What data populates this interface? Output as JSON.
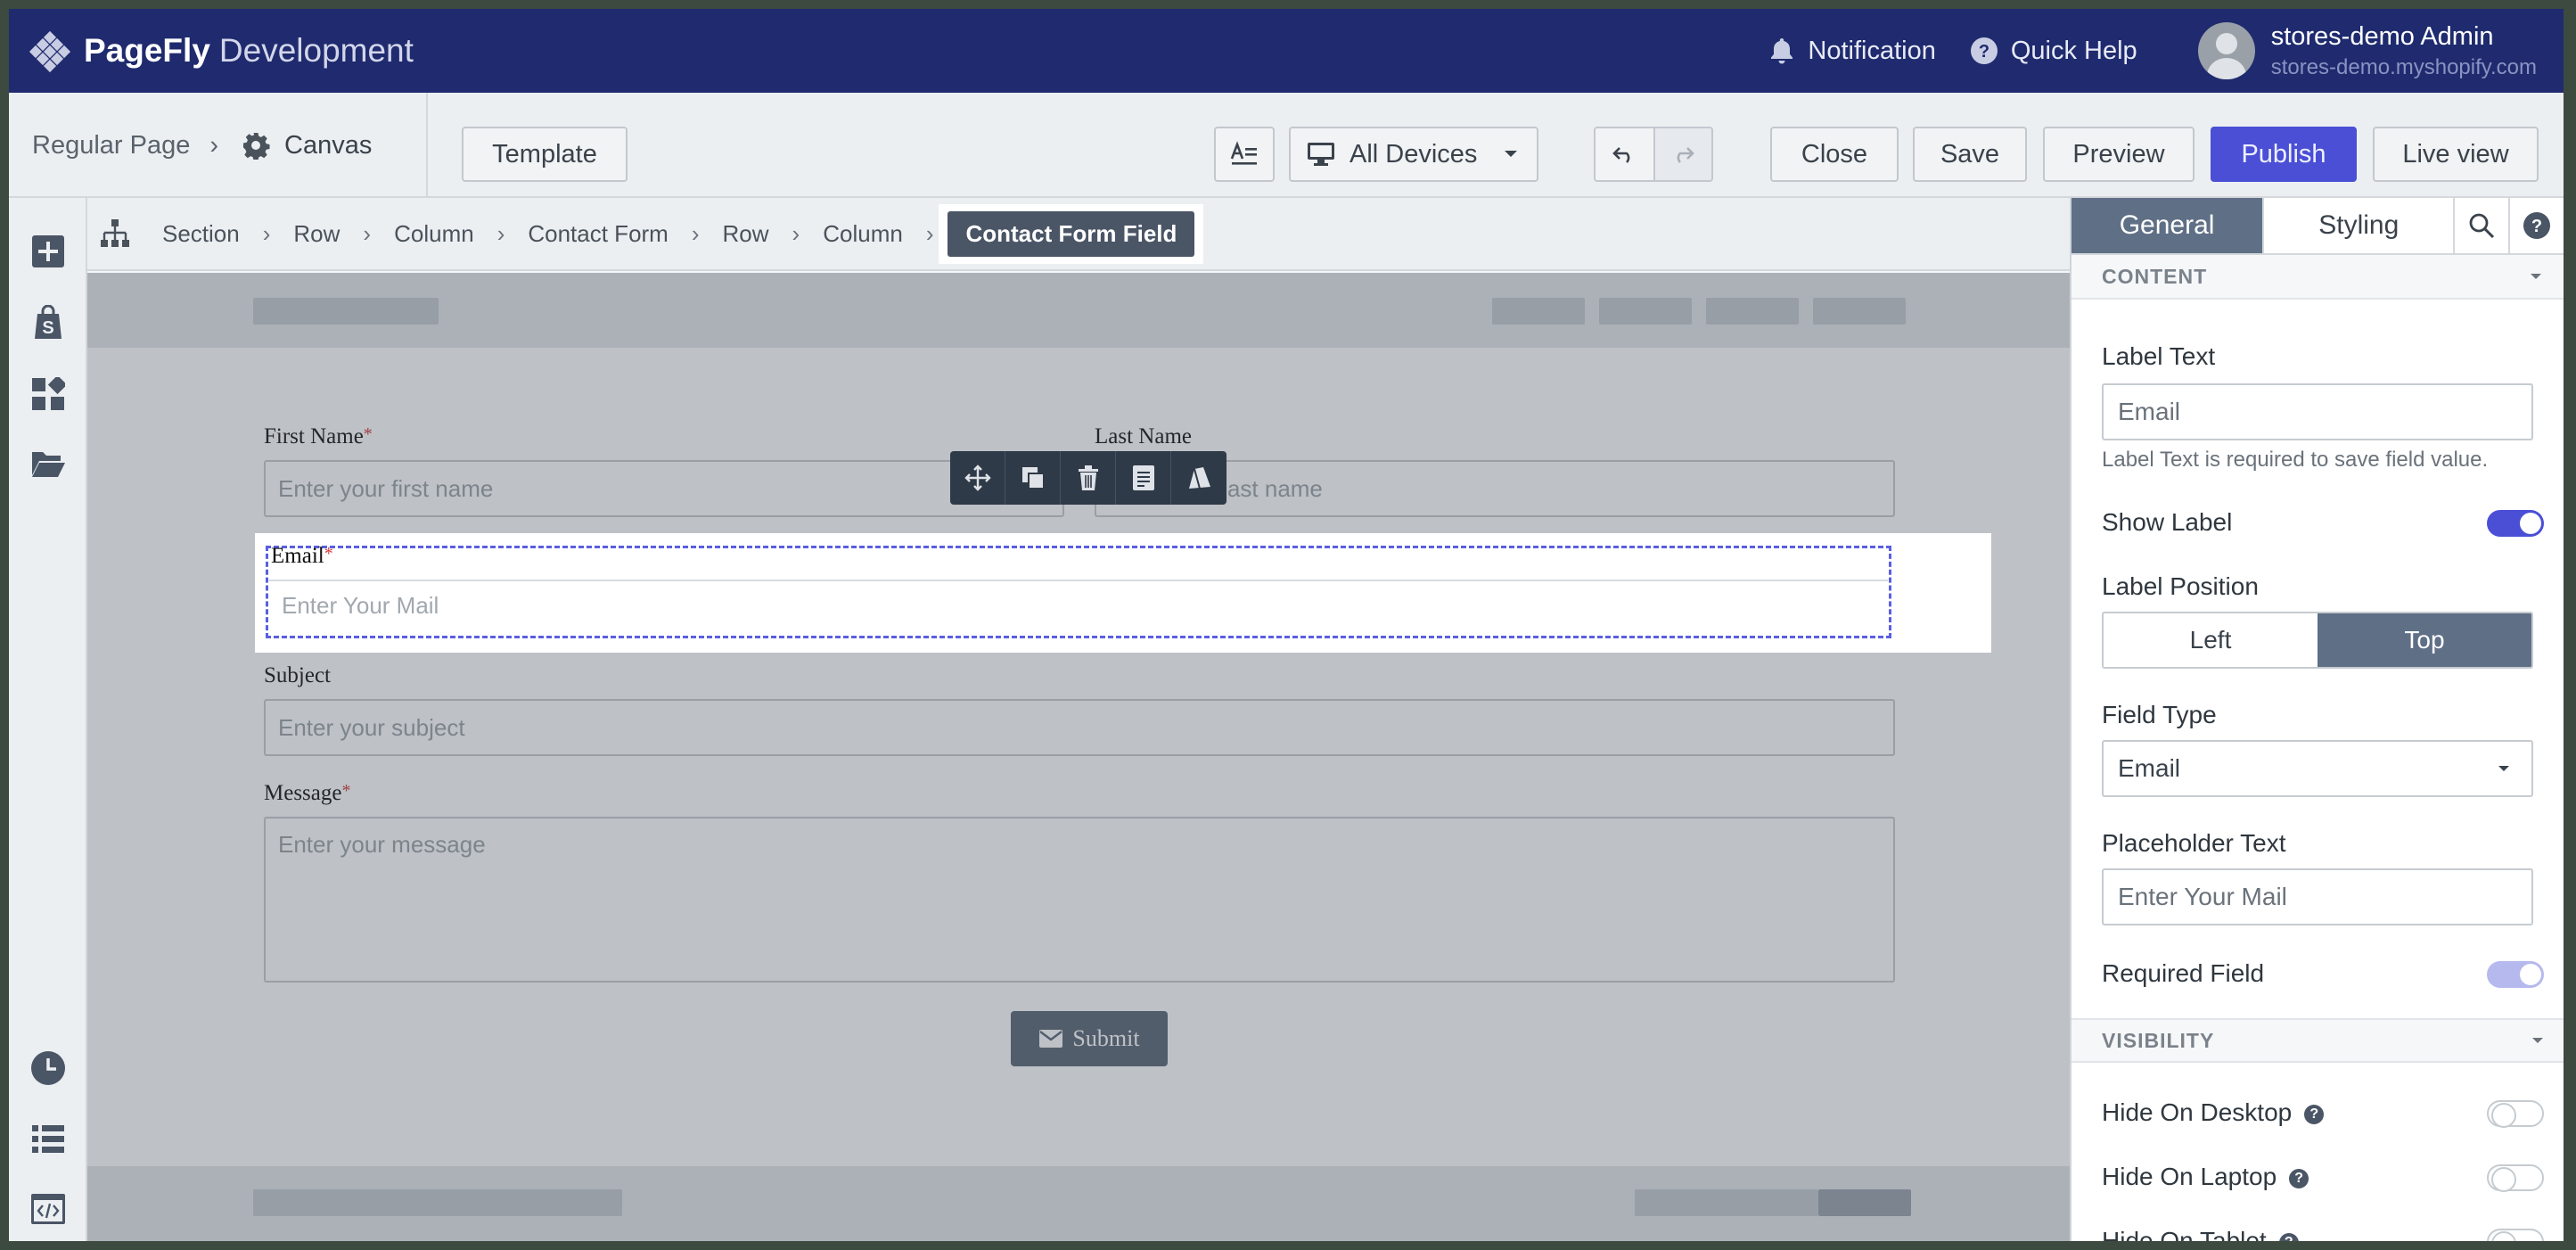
{
  "header": {
    "brand_name": "PageFly",
    "brand_env": "Development",
    "notification_label": "Notification",
    "help_label": "Quick Help",
    "user_name": "stores-demo Admin",
    "user_store": "stores-demo.myshopify.com"
  },
  "toolbar": {
    "page_type": "Regular Page",
    "canvas_label": "Canvas",
    "template_label": "Template",
    "device_label": "All Devices",
    "close_label": "Close",
    "save_label": "Save",
    "preview_label": "Preview",
    "publish_label": "Publish",
    "live_view_label": "Live view",
    "accent_color": "#4a4fd6"
  },
  "breadcrumb": {
    "items": [
      "Section",
      "Row",
      "Column",
      "Contact Form",
      "Row",
      "Column"
    ],
    "active": "Contact Form Field"
  },
  "form": {
    "first_name_label": "First Name",
    "first_name_placeholder": "Enter your first name",
    "last_name_label": "Last Name",
    "last_name_placeholder": "Enter your last name",
    "email_label": "Email",
    "email_placeholder": "Enter Your Mail",
    "subject_label": "Subject",
    "subject_placeholder": "Enter your subject",
    "message_label": "Message",
    "message_placeholder": "Enter your message",
    "submit_label": "Submit",
    "required_mark": "*"
  },
  "panel": {
    "tabs": [
      "General",
      "Styling"
    ],
    "active_tab": "General",
    "content_section": "CONTENT",
    "label_text_label": "Label Text",
    "label_text_value": "Email",
    "label_text_help": "Label Text is required to save field value.",
    "show_label": "Show Label",
    "label_position": "Label Position",
    "position_options": [
      "Left",
      "Top"
    ],
    "position_selected": "Top",
    "field_type_label": "Field Type",
    "field_type_value": "Email",
    "placeholder_label": "Placeholder Text",
    "placeholder_value": "Enter Your Mail",
    "required_field": "Required Field",
    "visibility_section": "VISIBILITY",
    "hide_desktop": "Hide On Desktop",
    "hide_laptop": "Hide On Laptop",
    "hide_tablet": "Hide On Tablet"
  }
}
